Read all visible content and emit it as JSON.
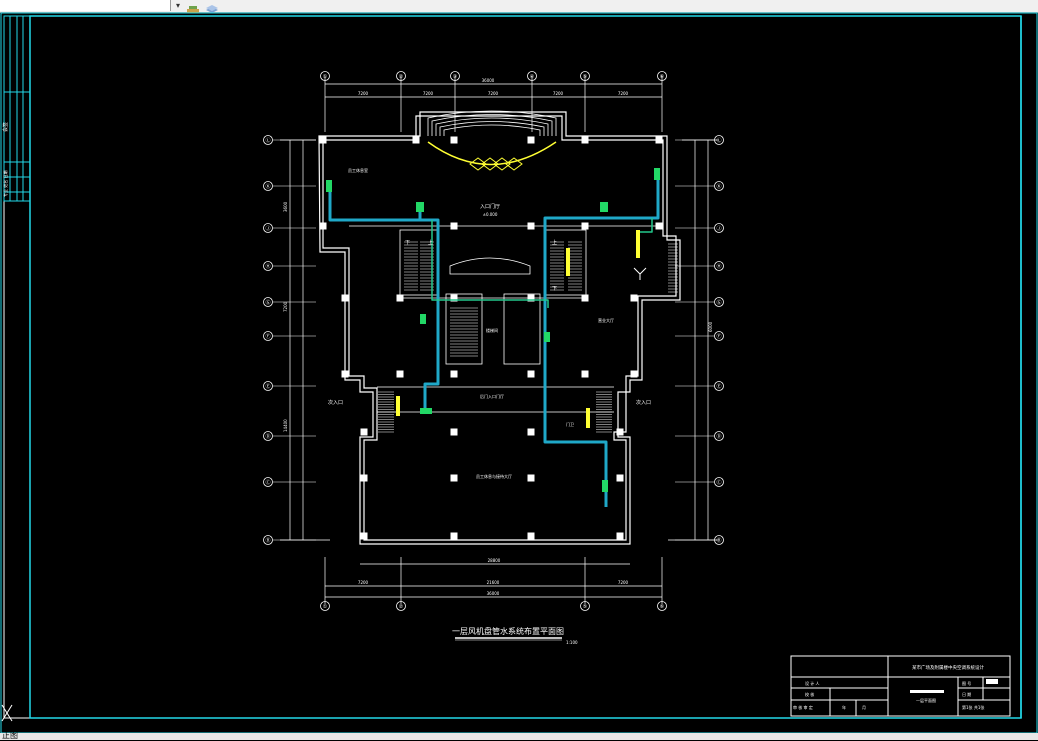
{
  "toolbar": {
    "layer_combo_value": "",
    "combo_arrow": "▾"
  },
  "drawing": {
    "title": "一层风机盘管水系统布置平面图",
    "scale": "1:100",
    "label_lobby": "入口门厅",
    "label_lobby_elev": "±0.000",
    "label_rear_entrance": "后门入口门厅",
    "label_office_left": "员工休息室",
    "label_office_right": "营业大厅",
    "label_stair": "楼梯间",
    "label_lower_hall": "员工休息与接待大厅",
    "label_side_left": "次入口",
    "label_side_right": "次入口",
    "label_up": "上",
    "label_down": "下",
    "label_guard": "门卫",
    "dims": {
      "total_top": "36000",
      "bay_a": "7200",
      "bay_b": "7200",
      "bay_c": "7200",
      "bay_d": "7200",
      "bay_e": "7200",
      "total_bottom": "36000",
      "bottom_a": "7200",
      "bottom_b": "21600",
      "bottom_c": "7200",
      "mid": "28800",
      "side_1": "3600",
      "side_2": "7200",
      "side_3": "14400",
      "side_4": "6000"
    },
    "axes_top": [
      "①",
      "②",
      "③",
      "④",
      "⑤",
      "⑥"
    ],
    "axes_left": [
      "Ⓛ",
      "Ⓚ",
      "Ⓙ",
      "Ⓗ",
      "Ⓖ",
      "Ⓕ",
      "Ⓔ",
      "Ⓓ",
      "Ⓒ",
      "Ⓑ",
      "Ⓐ"
    ]
  },
  "title_block": {
    "project": "某市广场及附属楼中央空调系统设计",
    "row_design": "设 计 人",
    "row_check": "校 核",
    "row_review": "审 核 审 定",
    "cell_a": "图 号",
    "cell_b": "日 期",
    "cell_c": "第1张 共1张",
    "drawing_name": "一层平面图",
    "date_1": "年",
    "date_2": "月"
  },
  "sidebar_strip": {
    "label_1": "会签",
    "label_2": "专业 姓名 日期"
  },
  "status": {
    "command_text": "正图"
  }
}
